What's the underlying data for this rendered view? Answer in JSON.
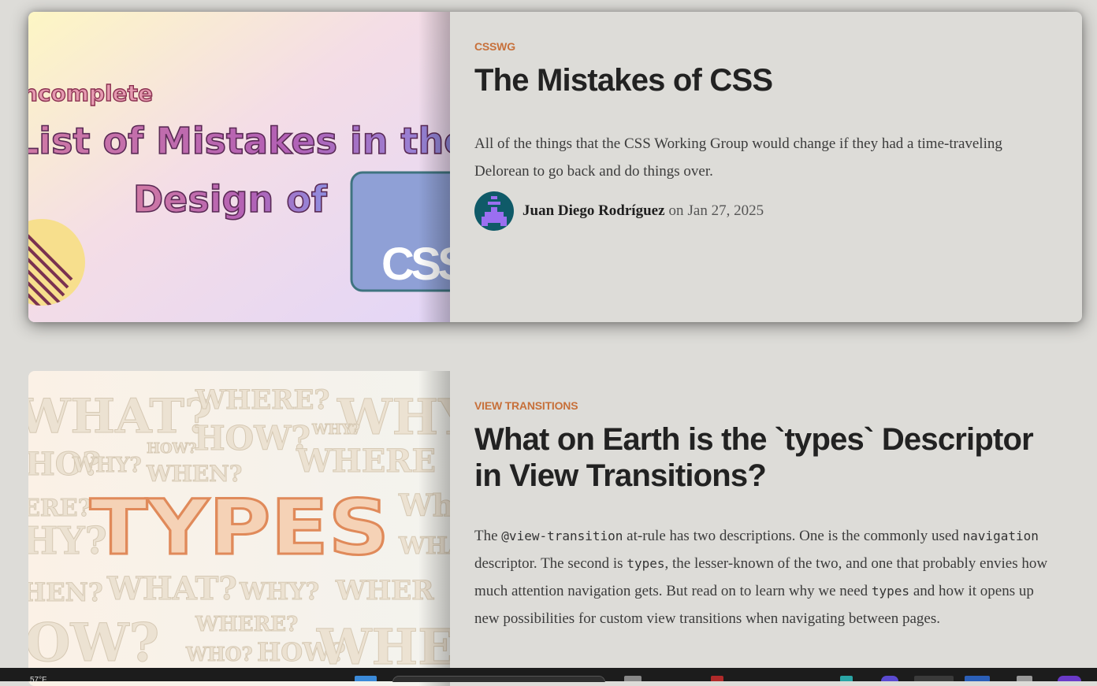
{
  "articles": [
    {
      "tag": "CSSWG",
      "title": "The Mistakes of CSS",
      "excerpt": "All of the things that the CSS Working Group would change if they had a time-traveling Delorean to go back and do things over.",
      "author": "Juan Diego Rodríguez",
      "date_prefix": "on",
      "date": "Jan 27, 2025",
      "image": {
        "line1": "ncomplete",
        "line2": "List of Mistakes in the",
        "line3": "Design of",
        "line4": "CSS"
      }
    },
    {
      "tag": "View Transitions",
      "title": "What on Earth is the `types` Descriptor in View Transitions?",
      "excerpt": {
        "p1": "The",
        "c1": "@view-transition",
        "p2": "at-rule has two descriptions. One is the commonly used",
        "c2": "navigation",
        "p3": "descriptor. The second is",
        "c3": "types",
        "p4": ", the lesser-known of the two, and one that probably envies how much attention navigation gets. But read on to learn why we need",
        "c4": "types",
        "p5": "and how it opens up new possibilities for custom view transitions when navigating between pages."
      },
      "image": {
        "main": "TYPES",
        "words": [
          "WHAT?",
          "WHERE?",
          "WHY",
          "HOW?",
          "WHY?",
          "HO?",
          "WHY?",
          "HOW?",
          "WHERE",
          "WHEN?",
          "ERE?",
          "Wh",
          "HY?",
          "WHA",
          "HEN?",
          "WHAT?",
          "WHY?",
          "WHER",
          "OW?",
          "WHERE?",
          "WHO?",
          "HOW?",
          "WHEN"
        ]
      }
    }
  ],
  "taskbar": {
    "weather": "57°F"
  },
  "colors": {
    "tag": "#c7703a",
    "background": "#dddcd8",
    "title": "#222222"
  }
}
